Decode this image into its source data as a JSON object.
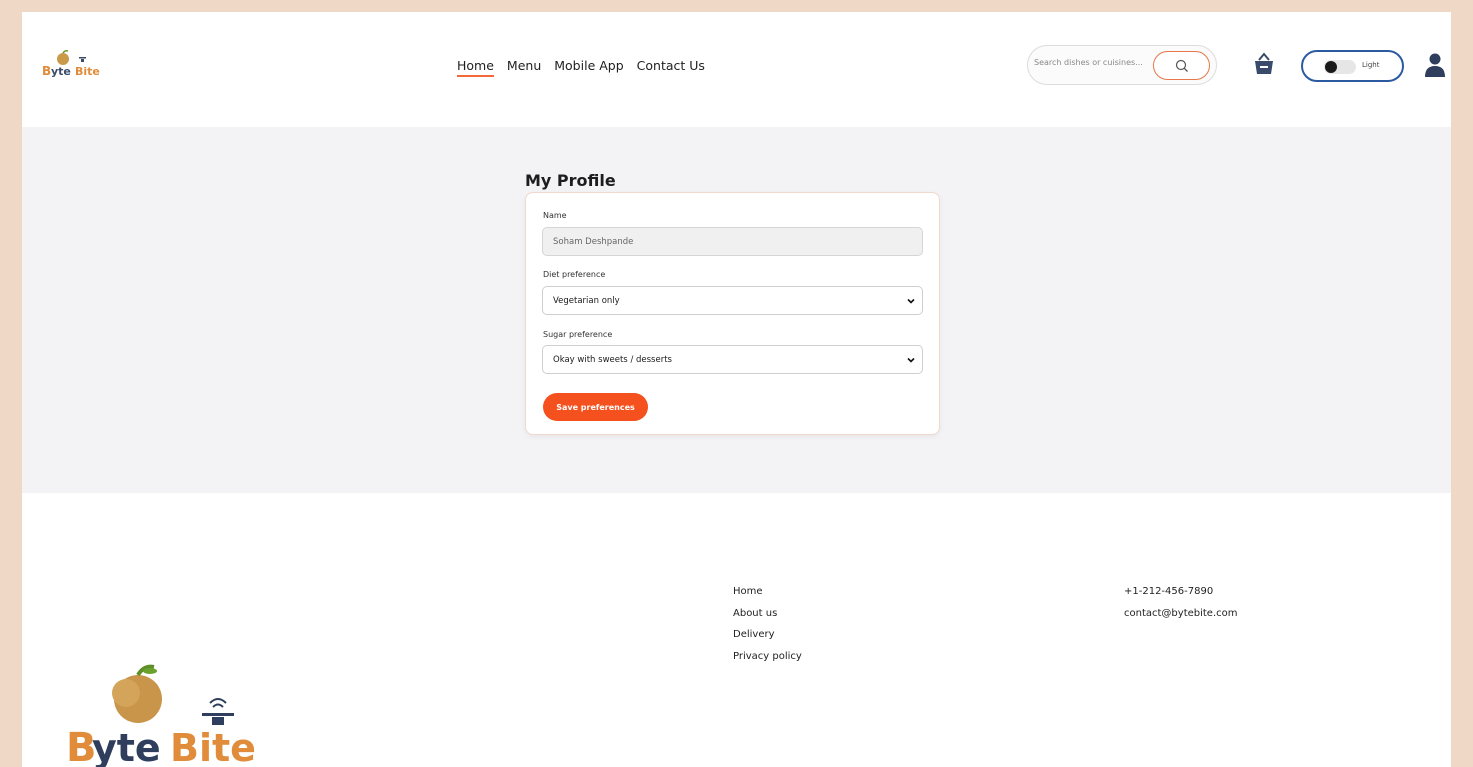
{
  "brand": {
    "name": "ByteBite"
  },
  "nav": {
    "items": [
      "Home",
      "Menu",
      "Mobile App",
      "Contact Us"
    ],
    "active": "Home"
  },
  "search": {
    "placeholder": "Search dishes or cuisines..."
  },
  "theme": {
    "label": "Light"
  },
  "profile": {
    "title": "My Profile",
    "name_label": "Name",
    "name_value": "Soham Deshpande",
    "diet_label": "Diet preference",
    "diet_value": "Vegetarian only",
    "sugar_label": "Sugar preference",
    "sugar_value": "Okay with sweets / desserts",
    "save_label": "Save preferences"
  },
  "footer": {
    "links": [
      "Home",
      "About us",
      "Delivery",
      "Privacy policy"
    ],
    "phone": "+1-212-456-7890",
    "email": "contact@bytebite.com"
  },
  "colors": {
    "accent": "#f4511e",
    "toggle_border": "#2c5aa0",
    "cart_icon": "#3a4a6b",
    "background": "#efd9c6"
  },
  "icons": [
    "apple-logo-icon",
    "drone-icon",
    "search-icon",
    "basket-icon",
    "user-icon",
    "chevron-down-icon"
  ]
}
